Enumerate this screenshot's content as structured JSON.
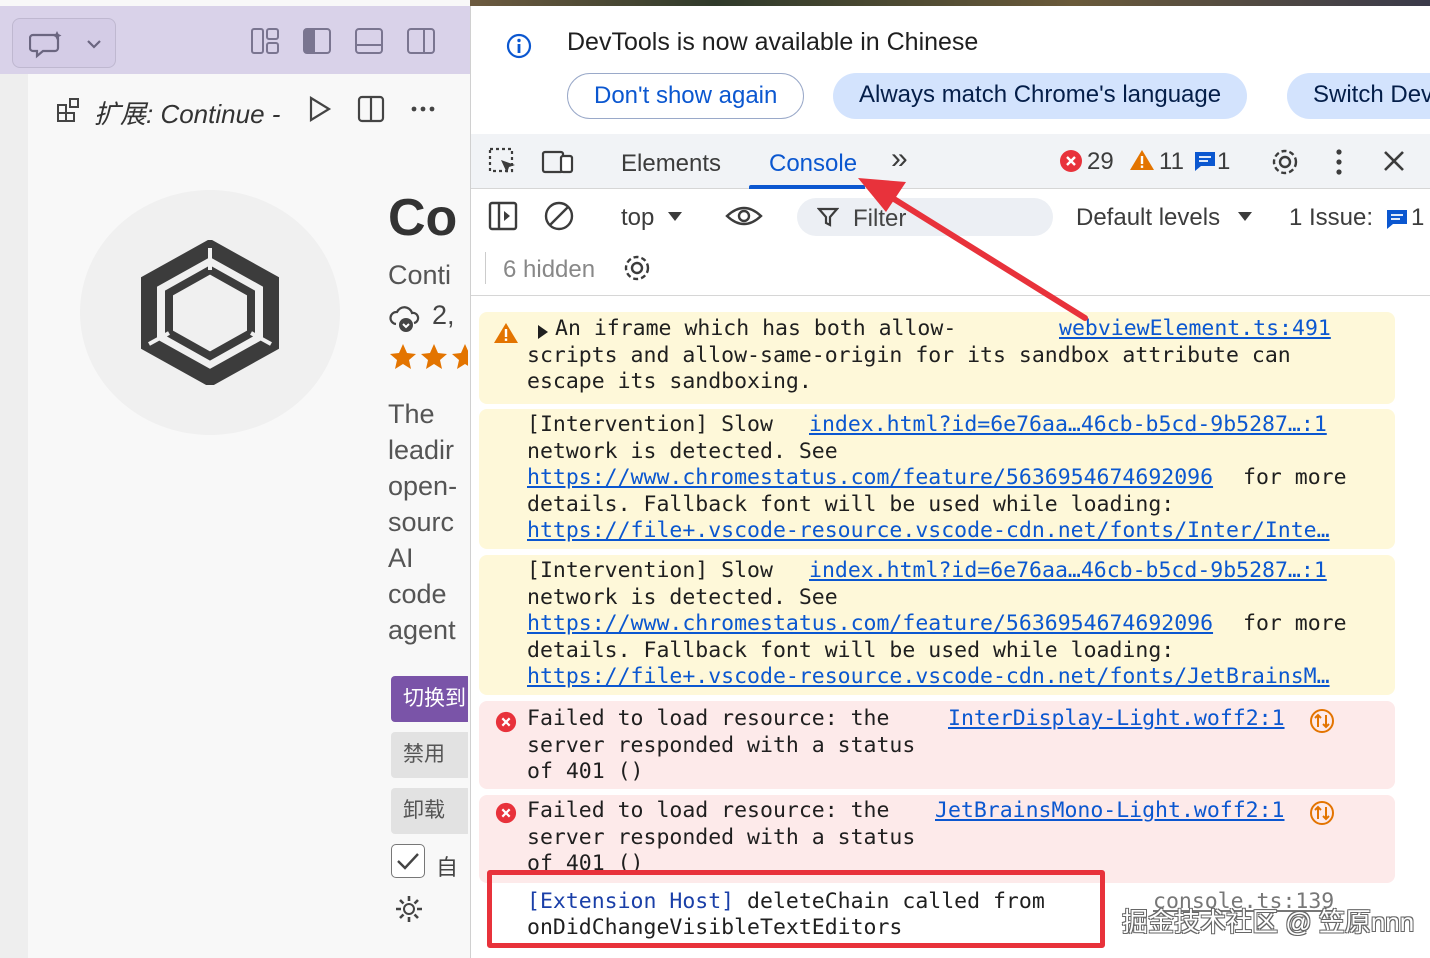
{
  "vscode": {
    "extension_tab_title": "扩展: Continue -",
    "ext_name": "Co",
    "publisher": "Conti",
    "installs": "2,",
    "description": [
      "The",
      "leadir",
      "open-",
      "sourc",
      "AI",
      "code",
      "agent"
    ],
    "buttons": {
      "switch": "切换到",
      "disable": "禁用",
      "uninstall": "卸载"
    },
    "auto_update_label": "自"
  },
  "devtools": {
    "banner": {
      "message": "DevTools is now available in Chinese",
      "dont_show": "Don't show again",
      "always_match": "Always match Chrome's language",
      "switch": "Switch DevTools to Chinese"
    },
    "tabs": {
      "elements": "Elements",
      "console": "Console",
      "more": "»"
    },
    "counts": {
      "errors": "29",
      "warnings": "11",
      "messages": "1"
    },
    "toolbar": {
      "context": "top",
      "filter_placeholder": "Filter",
      "levels": "Default levels",
      "issues_label": "1 Issue:",
      "issues_count": "1",
      "hidden": "6 hidden"
    },
    "messages": [
      {
        "level": "warning",
        "lines": [
          "An iframe which has both allow-",
          "scripts and allow-same-origin for its sandbox attribute can",
          "escape its sandboxing."
        ],
        "source": "webviewElement.ts:491"
      },
      {
        "level": "warning",
        "lines": [
          "[Intervention] Slow",
          "network is detected. See",
          "for more",
          "details. Fallback font will be used while loading:"
        ],
        "links": [
          "https://www.chromestatus.com/feature/5636954674692096",
          "https://file+.vscode-resource.vscode-cdn.net/fonts/Inter/Inte…"
        ],
        "source": "index.html?id=6e76aa…46cb-b5cd-9b5287…:1"
      },
      {
        "level": "warning",
        "lines": [
          "[Intervention] Slow",
          "network is detected. See",
          "for more",
          "details. Fallback font will be used while loading:"
        ],
        "links": [
          "https://www.chromestatus.com/feature/5636954674692096",
          "https://file+.vscode-resource.vscode-cdn.net/fonts/JetBrainsM…"
        ],
        "source": "index.html?id=6e76aa…46cb-b5cd-9b5287…:1"
      },
      {
        "level": "error",
        "lines": [
          "Failed to load resource: the",
          "server responded with a status",
          "of 401 ()"
        ],
        "source": "InterDisplay-Light.woff2:1"
      },
      {
        "level": "error",
        "lines": [
          "Failed to load resource: the",
          "server responded with a status",
          "of 401 ()"
        ],
        "source": "JetBrainsMono-Light.woff2:1"
      },
      {
        "level": "log",
        "prefix": "[Extension Host]",
        "lines": [
          " deleteChain called from",
          "onDidChangeVisibleTextEditors"
        ],
        "source": "console.ts:139"
      }
    ]
  },
  "watermark": "掘金技术社区 @ 笠原nnn",
  "colors": {
    "accent": "#0b57d0",
    "error": "#e8323b",
    "warning": "#e37400",
    "annotation": "#e8323b"
  }
}
